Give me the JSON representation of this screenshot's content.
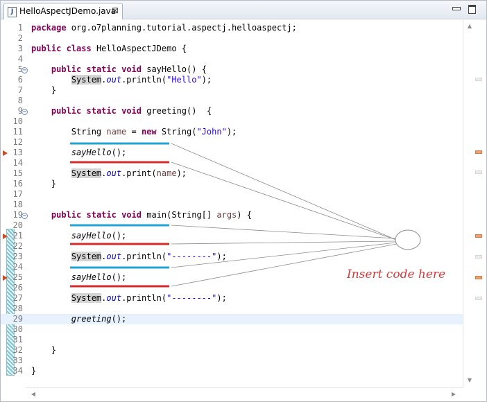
{
  "tab": {
    "title": "HelloAspectJDemo.java",
    "icon_name": "java-file-icon",
    "close_glyph": "⊠"
  },
  "annotation": {
    "text": "Insert code here",
    "color": "#d13c3c"
  },
  "colors": {
    "keyword": "#7f0055",
    "string": "#2a00ff",
    "blue_underline": "#22a3d6",
    "red_underline": "#d42b2b",
    "current_line": "#e8f2fe"
  },
  "lines": [
    {
      "n": "1",
      "segs": [
        {
          "t": "package",
          "c": "kw"
        },
        {
          "t": " org.o7planning.tutorial.aspectj.helloaspectj;"
        }
      ]
    },
    {
      "n": "2",
      "segs": []
    },
    {
      "n": "3",
      "segs": [
        {
          "t": "public",
          "c": "kw"
        },
        {
          "t": " "
        },
        {
          "t": "class",
          "c": "kw"
        },
        {
          "t": " HelloAspectJDemo {"
        }
      ]
    },
    {
      "n": "4",
      "segs": []
    },
    {
      "n": "5",
      "fold": true,
      "segs": [
        {
          "t": "    "
        },
        {
          "t": "public",
          "c": "kw"
        },
        {
          "t": " "
        },
        {
          "t": "static",
          "c": "kw"
        },
        {
          "t": " "
        },
        {
          "t": "void",
          "c": "kw"
        },
        {
          "t": " sayHello() {"
        }
      ]
    },
    {
      "n": "6",
      "segs": [
        {
          "t": "        "
        },
        {
          "t": "System",
          "c": "hl"
        },
        {
          "t": "."
        },
        {
          "t": "out",
          "c": "fld"
        },
        {
          "t": ".println("
        },
        {
          "t": "\"Hello\"",
          "c": "str"
        },
        {
          "t": ");"
        }
      ]
    },
    {
      "n": "7",
      "segs": [
        {
          "t": "    }"
        }
      ]
    },
    {
      "n": "8",
      "segs": []
    },
    {
      "n": "9",
      "fold": true,
      "segs": [
        {
          "t": "    "
        },
        {
          "t": "public",
          "c": "kw"
        },
        {
          "t": " "
        },
        {
          "t": "static",
          "c": "kw"
        },
        {
          "t": " "
        },
        {
          "t": "void",
          "c": "kw"
        },
        {
          "t": " greeting()  {"
        }
      ]
    },
    {
      "n": "10",
      "segs": []
    },
    {
      "n": "11",
      "segs": [
        {
          "t": "        String "
        },
        {
          "t": "name",
          "c": "lv"
        },
        {
          "t": " = "
        },
        {
          "t": "new",
          "c": "kw"
        },
        {
          "t": " String("
        },
        {
          "t": "\"John\"",
          "c": "str"
        },
        {
          "t": ");"
        }
      ]
    },
    {
      "n": "12",
      "segs": []
    },
    {
      "n": "13",
      "arrow": true,
      "segs": [
        {
          "t": "        "
        },
        {
          "t": "sayHello",
          "c": "mc"
        },
        {
          "t": "();"
        }
      ]
    },
    {
      "n": "14",
      "segs": []
    },
    {
      "n": "15",
      "segs": [
        {
          "t": "        "
        },
        {
          "t": "System",
          "c": "hl"
        },
        {
          "t": "."
        },
        {
          "t": "out",
          "c": "fld"
        },
        {
          "t": ".print("
        },
        {
          "t": "name",
          "c": "lv"
        },
        {
          "t": ");"
        }
      ]
    },
    {
      "n": "16",
      "segs": [
        {
          "t": "    }"
        }
      ]
    },
    {
      "n": "17",
      "segs": []
    },
    {
      "n": "18",
      "segs": []
    },
    {
      "n": "19",
      "fold": true,
      "segs": [
        {
          "t": "    "
        },
        {
          "t": "public",
          "c": "kw"
        },
        {
          "t": " "
        },
        {
          "t": "static",
          "c": "kw"
        },
        {
          "t": " "
        },
        {
          "t": "void",
          "c": "kw"
        },
        {
          "t": " main(String[] "
        },
        {
          "t": "args",
          "c": "lv"
        },
        {
          "t": ") {"
        }
      ]
    },
    {
      "n": "20",
      "segs": []
    },
    {
      "n": "21",
      "arrow": true,
      "segs": [
        {
          "t": "        "
        },
        {
          "t": "sayHello",
          "c": "mc"
        },
        {
          "t": "();"
        }
      ]
    },
    {
      "n": "22",
      "segs": []
    },
    {
      "n": "23",
      "segs": [
        {
          "t": "        "
        },
        {
          "t": "System",
          "c": "hl"
        },
        {
          "t": "."
        },
        {
          "t": "out",
          "c": "fld"
        },
        {
          "t": ".println("
        },
        {
          "t": "\"--------\"",
          "c": "str"
        },
        {
          "t": ");"
        }
      ]
    },
    {
      "n": "24",
      "segs": []
    },
    {
      "n": "25",
      "arrow": true,
      "segs": [
        {
          "t": "        "
        },
        {
          "t": "sayHello",
          "c": "mc"
        },
        {
          "t": "();"
        }
      ]
    },
    {
      "n": "26",
      "segs": []
    },
    {
      "n": "27",
      "segs": [
        {
          "t": "        "
        },
        {
          "t": "System",
          "c": "hl"
        },
        {
          "t": "."
        },
        {
          "t": "out",
          "c": "fld"
        },
        {
          "t": ".println("
        },
        {
          "t": "\"--------\"",
          "c": "str"
        },
        {
          "t": ");"
        }
      ]
    },
    {
      "n": "28",
      "segs": []
    },
    {
      "n": "29",
      "current": true,
      "segs": [
        {
          "t": "        "
        },
        {
          "t": "greeting",
          "c": "mc"
        },
        {
          "t": "();"
        }
      ]
    },
    {
      "n": "30",
      "segs": []
    },
    {
      "n": "31",
      "segs": []
    },
    {
      "n": "32",
      "segs": [
        {
          "t": "    }"
        }
      ]
    },
    {
      "n": "33",
      "segs": []
    },
    {
      "n": "34",
      "segs": [
        {
          "t": "}"
        }
      ]
    }
  ]
}
